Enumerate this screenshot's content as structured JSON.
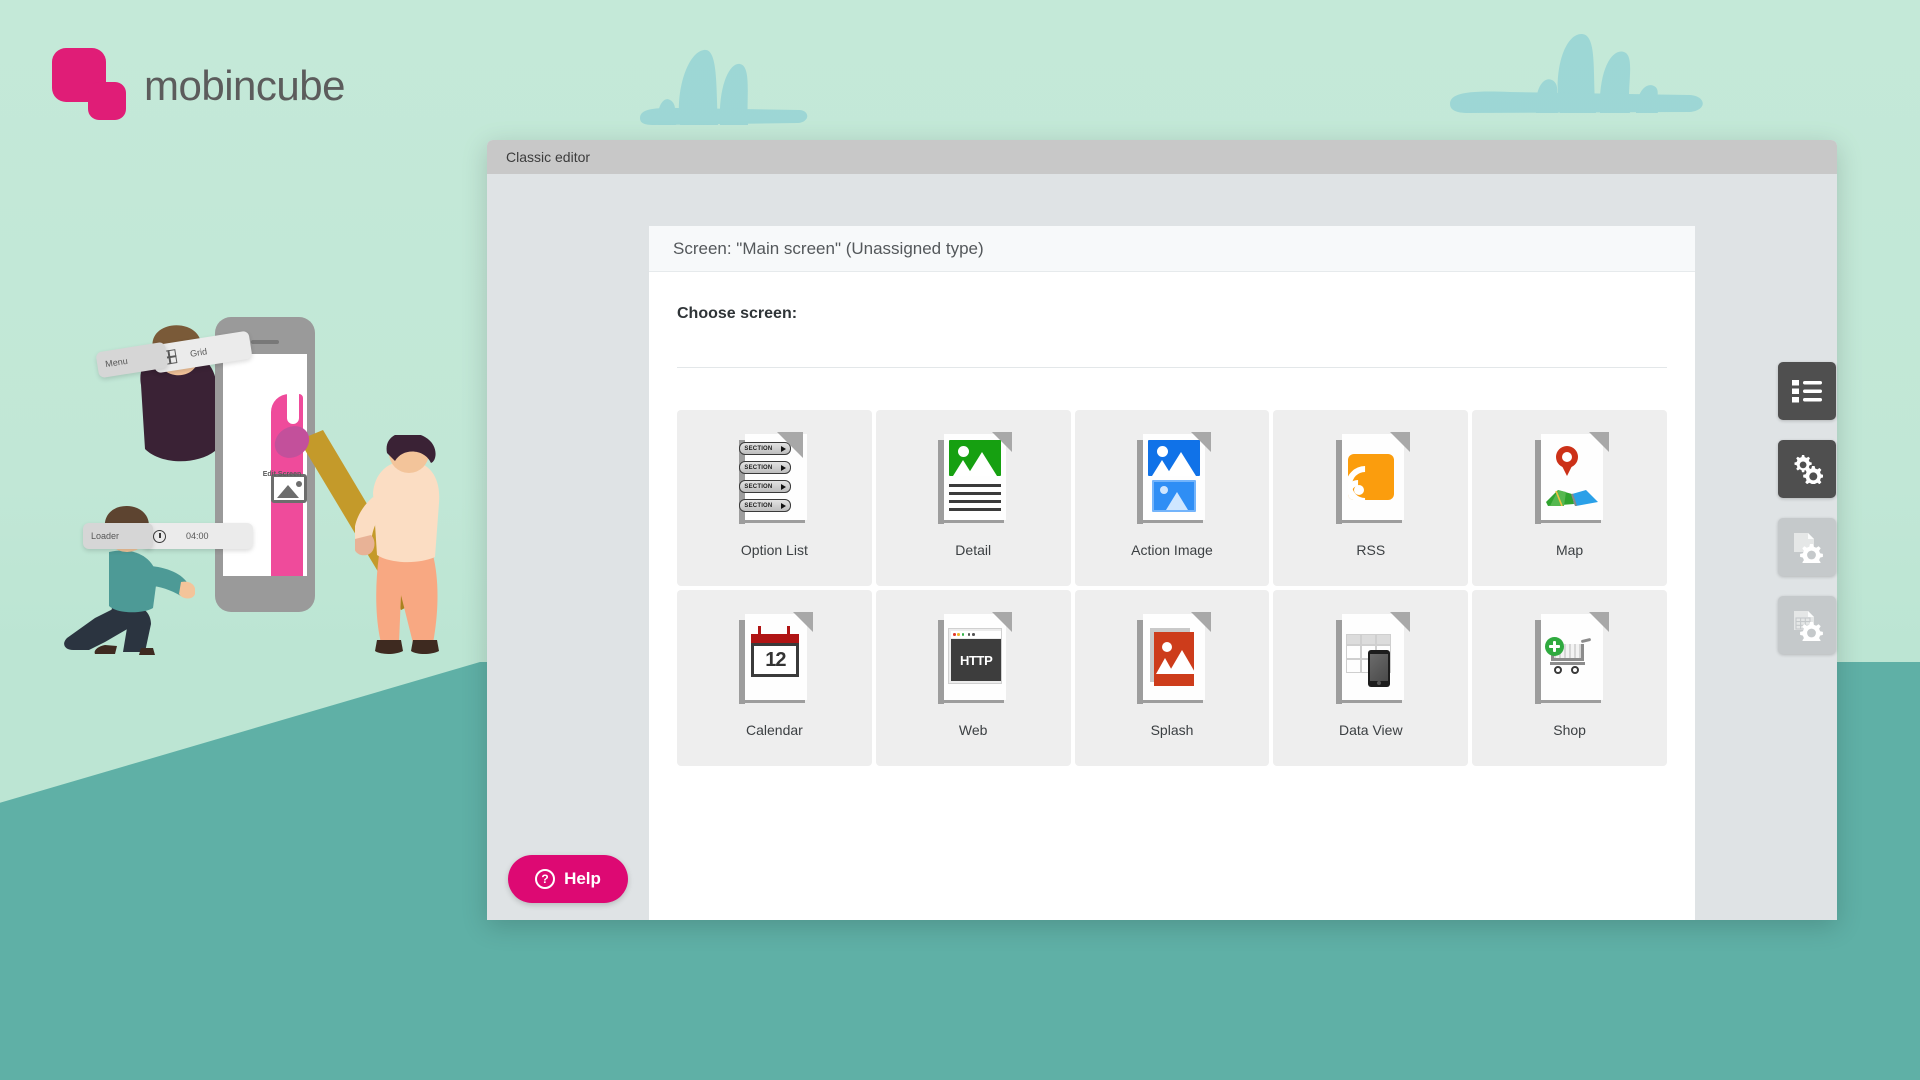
{
  "brand": {
    "name": "mobincube",
    "logo_color": "#e01d77"
  },
  "illustration": {
    "chips": [
      {
        "label": "Menu"
      },
      {
        "label": "Grid",
        "icon": "grid-icon"
      },
      {
        "label": "Loader"
      },
      {
        "label": "04:00",
        "icon": "clock-icon"
      }
    ],
    "phone_label": "Edit Screen"
  },
  "dialog": {
    "title": "Classic editor",
    "panel_header": "Screen: \"Main screen\" (Unassigned type)",
    "section_title": "Choose screen:"
  },
  "screen_types": {
    "rows": [
      [
        {
          "label": "Option List",
          "icon": "option-list-icon",
          "section_label": "SECTION"
        },
        {
          "label": "Detail",
          "icon": "detail-icon",
          "accent": "#16a011"
        },
        {
          "label": "Action Image",
          "icon": "action-image-icon",
          "accent": "#1072e8"
        },
        {
          "label": "RSS",
          "icon": "rss-icon",
          "accent": "#fb9d0d"
        },
        {
          "label": "Map",
          "icon": "map-icon",
          "accent": "#cc3118"
        }
      ],
      [
        {
          "label": "Calendar",
          "icon": "calendar-icon",
          "accent": "#b01414",
          "day": "12"
        },
        {
          "label": "Web",
          "icon": "web-icon",
          "protocol": "HTTP"
        },
        {
          "label": "Splash",
          "icon": "splash-icon",
          "accent": "#cd3c1b"
        },
        {
          "label": "Data View",
          "icon": "data-view-icon"
        },
        {
          "label": "Shop",
          "icon": "shop-icon",
          "accent": "#2faa3f"
        }
      ]
    ]
  },
  "help": {
    "label": "Help",
    "glyph": "?",
    "color": "#dd0973"
  },
  "toolbar": {
    "buttons": [
      {
        "name": "screens-list",
        "icon": "list-icon",
        "state": "active"
      },
      {
        "name": "app-settings",
        "icon": "gears-icon",
        "state": "active"
      },
      {
        "name": "page-settings",
        "icon": "page-gear-icon",
        "state": "disabled"
      },
      {
        "name": "data-settings",
        "icon": "table-gear-icon",
        "state": "disabled"
      }
    ]
  }
}
